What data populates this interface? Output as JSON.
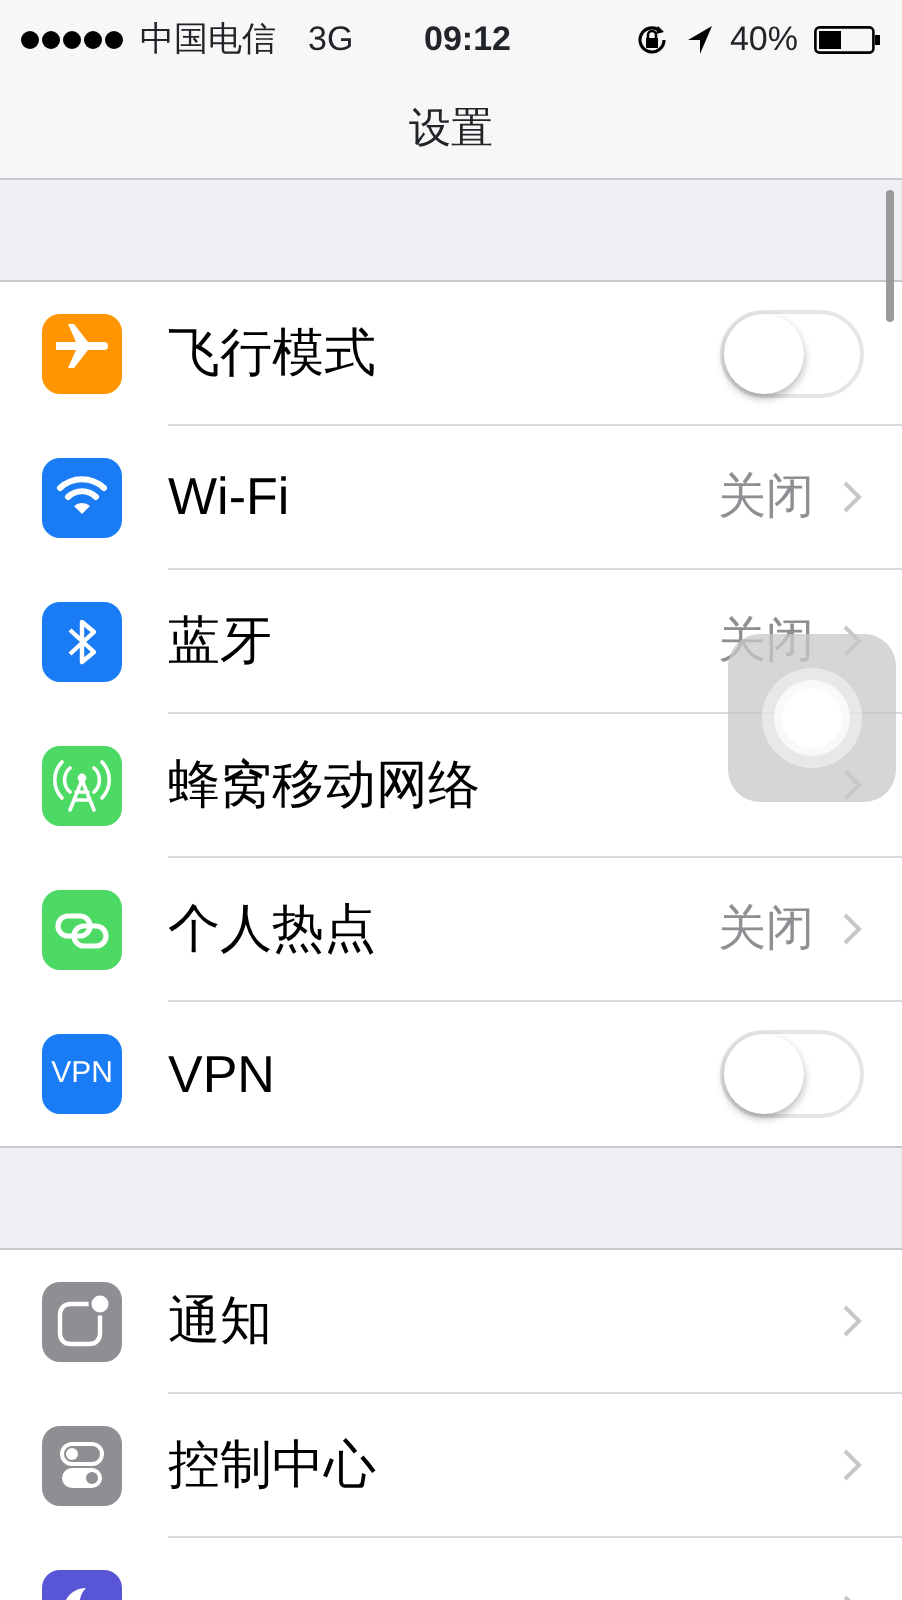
{
  "status_bar": {
    "carrier": "中国电信",
    "network": "3G",
    "time": "09:12",
    "battery": "40%"
  },
  "title": "设置",
  "groups": [
    {
      "rows": [
        {
          "label": "飞行模式",
          "kind": "toggle",
          "on": false,
          "color": "#ff9500"
        },
        {
          "label": "Wi-Fi",
          "kind": "detail",
          "value": "关闭",
          "color": "#1a7cf5"
        },
        {
          "label": "蓝牙",
          "kind": "detail",
          "value": "关闭",
          "color": "#1a7cf5"
        },
        {
          "label": "蜂窝移动网络",
          "kind": "link",
          "color": "#4cd964"
        },
        {
          "label": "个人热点",
          "kind": "detail",
          "value": "关闭",
          "color": "#4cd964"
        },
        {
          "label": "VPN",
          "kind": "toggle",
          "on": false,
          "color": "#1a7cf5",
          "icon_text": "VPN"
        }
      ]
    },
    {
      "rows": [
        {
          "label": "通知",
          "kind": "link",
          "color": "#8e8e93"
        },
        {
          "label": "控制中心",
          "kind": "link",
          "color": "#8e8e93"
        },
        {
          "kind": "link",
          "color": "#5856d6"
        }
      ]
    }
  ]
}
